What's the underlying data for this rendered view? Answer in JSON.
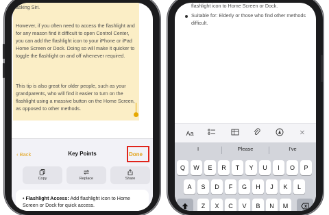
{
  "left_note": {
    "paragraphs": [
      "asking Siri.",
      "However, if you often need to access the flashlight and for any reason find it difficult to open Control Center, you can add the flashlight icon to your iPhone or iPad Home Screen or Dock. Doing so will make it quicker to toggle the flashlight on and off whenever required.",
      "This tip is also great for older people, such as your grandparents, who will find it easier to turn on the flashlight using a massive button on the Home Screen, as opposed to other methods."
    ]
  },
  "key_points_sheet": {
    "back_label": "Back",
    "title": "Key Points",
    "done_label": "Done",
    "actions": [
      {
        "label": "Copy",
        "icon": "copy-icon"
      },
      {
        "label": "Replace",
        "icon": "replace-icon"
      },
      {
        "label": "Share",
        "icon": "share-icon"
      }
    ],
    "result_bold": "Flashlight Access:",
    "result_text": " Add flashlight icon to Home Screen or Dock for quick access."
  },
  "right_note": {
    "top_text": "flashlight icon to Home Screen or Dock.",
    "bullet_text": "Suitable for: Elderly or those who find other methods difficult."
  },
  "format_toolbar": {
    "items": [
      {
        "label": "Aa",
        "icon": "text-format-icon"
      },
      {
        "label": "",
        "icon": "checklist-icon"
      },
      {
        "label": "",
        "icon": "table-icon"
      },
      {
        "label": "",
        "icon": "paperclip-icon"
      },
      {
        "label": "",
        "icon": "markup-pen-icon"
      },
      {
        "label": "",
        "icon": "close-icon"
      }
    ]
  },
  "keyboard": {
    "predictions": [
      "I",
      "Please",
      "I've"
    ],
    "row1": [
      "Q",
      "W",
      "E",
      "R",
      "T",
      "Y",
      "U",
      "I",
      "O",
      "P"
    ],
    "row2": [
      "A",
      "S",
      "D",
      "F",
      "G",
      "H",
      "J",
      "K",
      "L"
    ],
    "row3": [
      "Z",
      "X",
      "C",
      "V",
      "B",
      "N",
      "M"
    ]
  },
  "colors": {
    "accent": "#e2a31a",
    "selection_highlight": "#fbeec6",
    "annotation_box": "#e0241b"
  }
}
